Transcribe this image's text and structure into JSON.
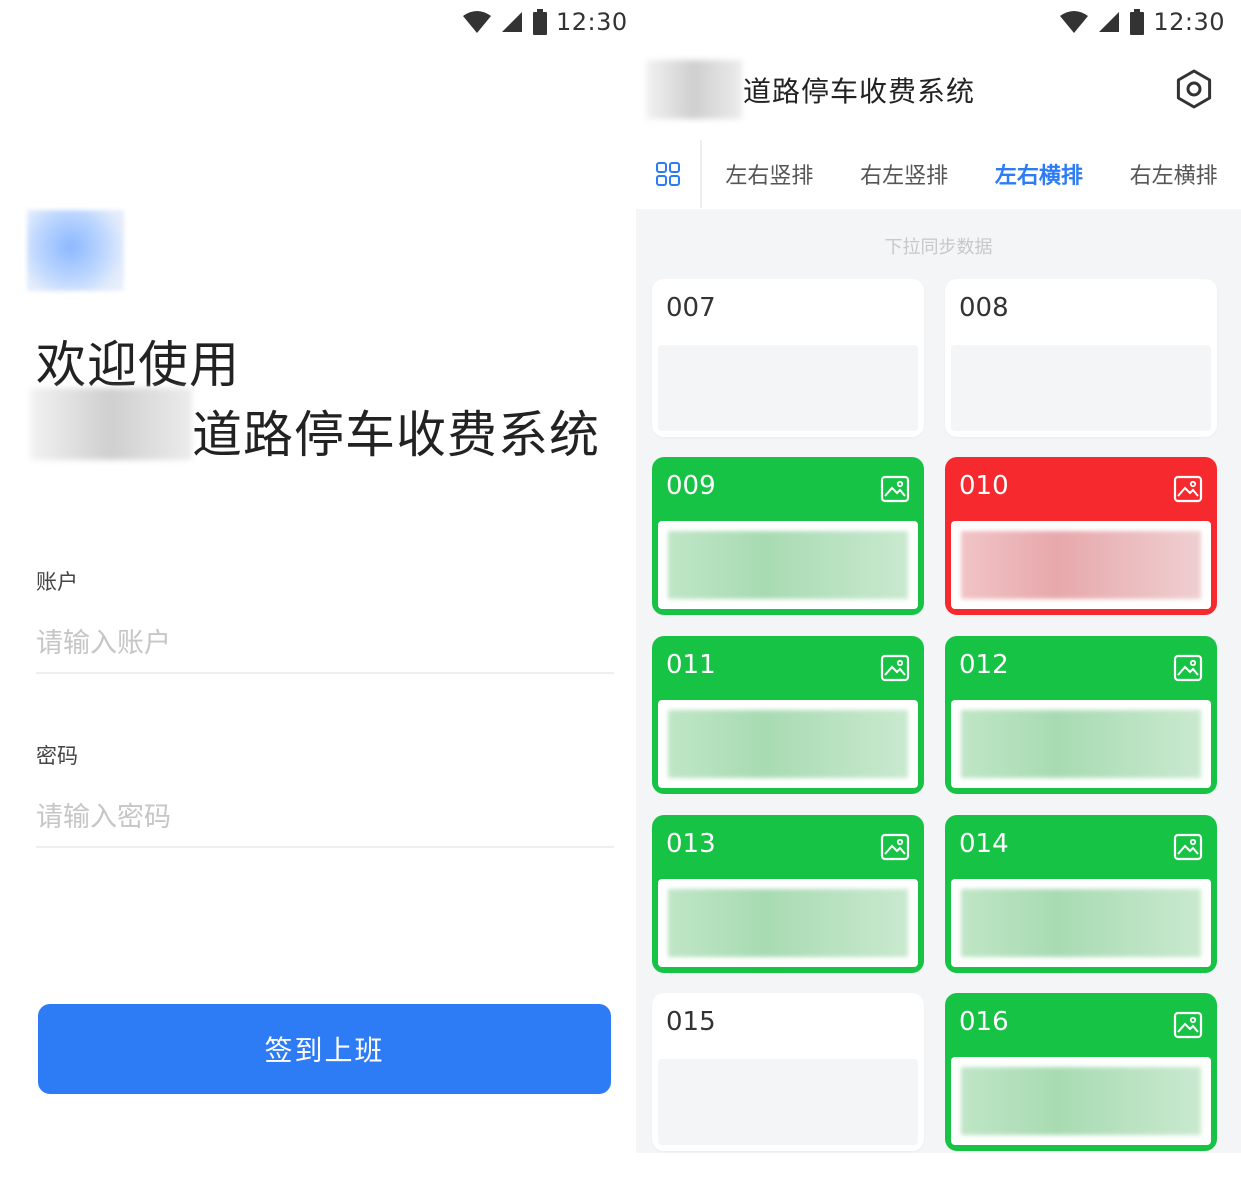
{
  "status_bar": {
    "time": "12:30"
  },
  "login": {
    "welcome": "欢迎使用",
    "system_title": "道路停车收费系统",
    "account_label": "账户",
    "account_placeholder": "请输入账户",
    "password_label": "密码",
    "password_placeholder": "请输入密码",
    "submit_label": "签到上班"
  },
  "parking": {
    "title": "道路停车收费系统",
    "tabs": [
      {
        "label": "左右竖排",
        "active": false
      },
      {
        "label": "右左竖排",
        "active": false
      },
      {
        "label": "左右横排",
        "active": true
      },
      {
        "label": "右左横排",
        "active": false
      }
    ],
    "pull_hint": "下拉同步数据",
    "spaces": [
      {
        "number": "007",
        "status": "empty"
      },
      {
        "number": "008",
        "status": "empty"
      },
      {
        "number": "009",
        "status": "occupied"
      },
      {
        "number": "010",
        "status": "alert"
      },
      {
        "number": "011",
        "status": "occupied"
      },
      {
        "number": "012",
        "status": "occupied"
      },
      {
        "number": "013",
        "status": "occupied"
      },
      {
        "number": "014",
        "status": "occupied"
      },
      {
        "number": "015",
        "status": "empty"
      },
      {
        "number": "016",
        "status": "occupied"
      }
    ]
  },
  "colors": {
    "primary": "#2d7cf6",
    "occupied": "#17c345",
    "alert": "#f5292e",
    "background": "#f4f5f7"
  },
  "icons": [
    "wifi-icon",
    "signal-icon",
    "battery-icon",
    "settings-icon",
    "grid-icon",
    "photo-icon"
  ]
}
